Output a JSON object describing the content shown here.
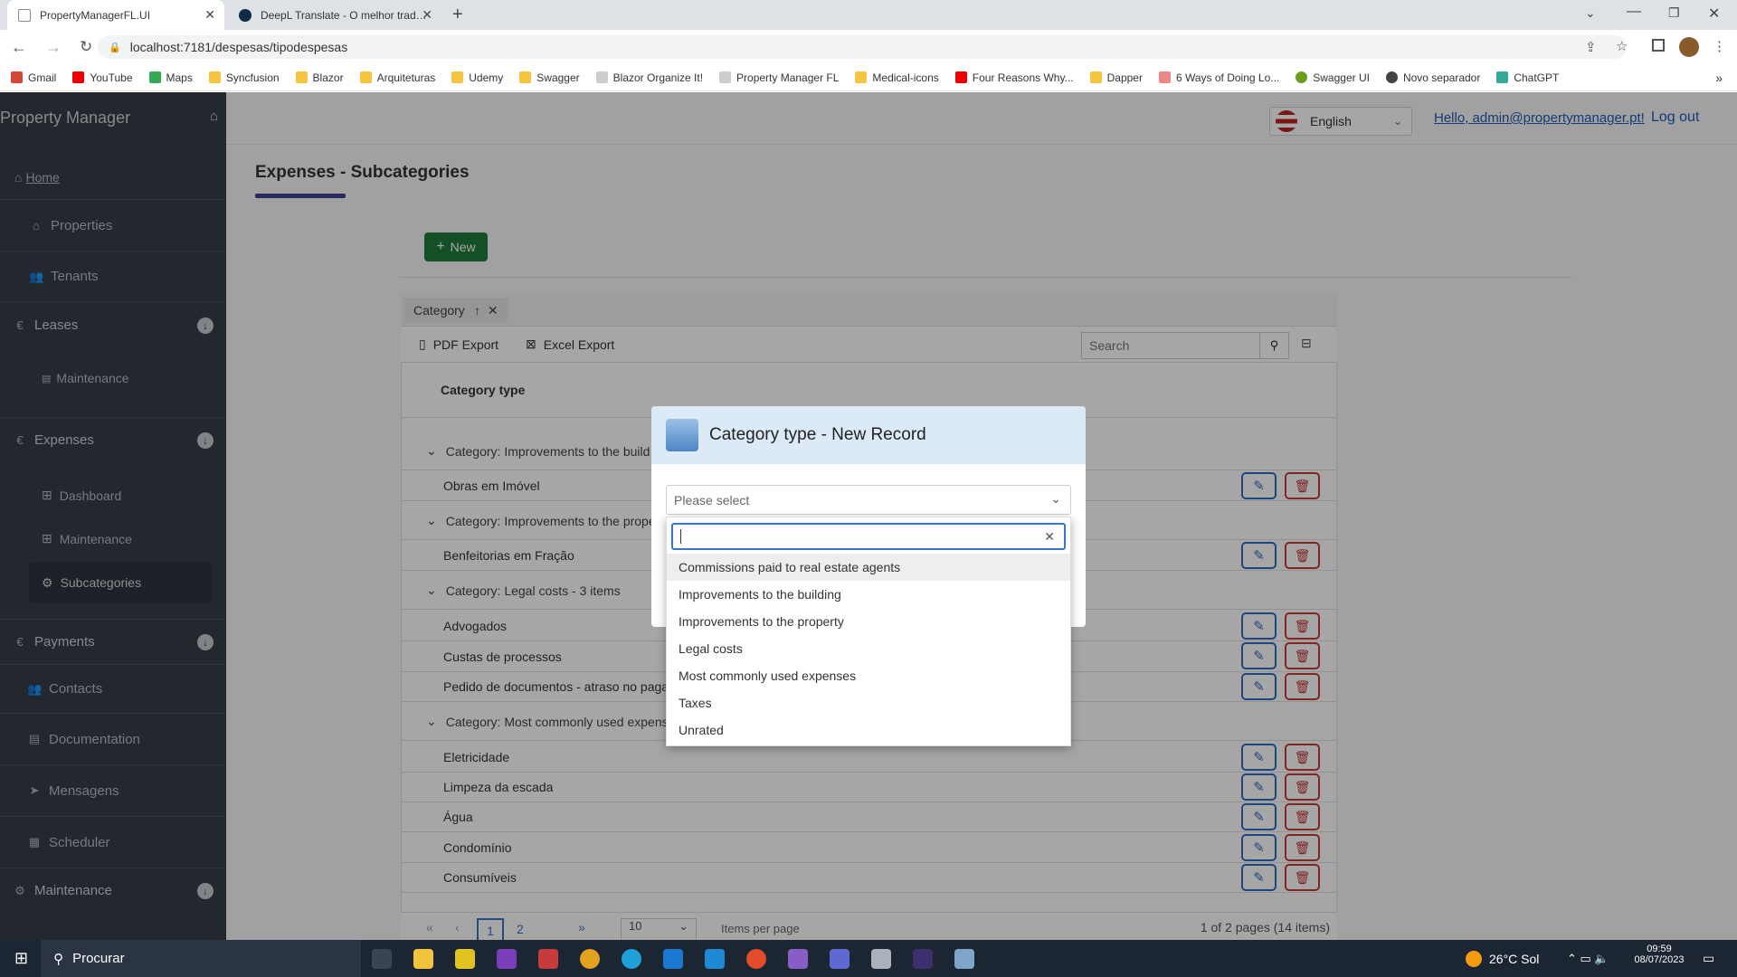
{
  "browser": {
    "tabs": [
      {
        "title": "PropertyManagerFL.UI"
      },
      {
        "title": "DeepL Translate - O melhor trad…"
      }
    ],
    "url": "localhost:7181/despesas/tipodespesas",
    "bookmarks": [
      "Gmail",
      "YouTube",
      "Maps",
      "Syncfusion",
      "Blazor",
      "Arquiteturas",
      "Udemy",
      "Swagger",
      "Blazor Organize It!",
      "Property Manager FL",
      "Medical-icons",
      "Four Reasons Why...",
      "Dapper",
      "6 Ways of Doing Lo...",
      "Swagger UI",
      "Novo separador",
      "ChatGPT"
    ]
  },
  "sidebar": {
    "brand": "Property Manager",
    "home": "Home",
    "items": {
      "properties": "Properties",
      "tenants": "Tenants",
      "leases": "Leases",
      "leases_maintenance": "Maintenance",
      "expenses": "Expenses",
      "dashboard": "Dashboard",
      "expenses_maintenance": "Maintenance",
      "subcategories": "Subcategories",
      "payments": "Payments",
      "contacts": "Contacts",
      "documentation": "Documentation",
      "mensagens": "Mensagens",
      "scheduler": "Scheduler",
      "maintenance": "Maintenance"
    }
  },
  "header": {
    "language": "English",
    "greeting": "Hello, admin@propertymanager.pt!",
    "logout": "Log out"
  },
  "page": {
    "title": "Expenses - Subcategories",
    "new_button": "New",
    "group_chip": "Category",
    "pdf_export": "PDF Export",
    "excel_export": "Excel Export",
    "search_placeholder": "Search",
    "column_header": "Category type",
    "groups": [
      {
        "caption": "Category: Improvements to the build",
        "rows": [
          "Obras em Imóvel"
        ]
      },
      {
        "caption": "Category: Improvements to the prope",
        "rows": [
          "Benfeitorias em Fração"
        ]
      },
      {
        "caption": "Category: Legal costs - 3 items",
        "rows": [
          "Advogados",
          "Custas de processos",
          "Pedido de documentos - atraso no paga"
        ]
      },
      {
        "caption": "Category: Most commonly used expens",
        "rows": [
          "Eletricidade",
          "Limpeza da escada",
          "Água",
          "Condomínio",
          "Consumíveis"
        ]
      }
    ],
    "pager": {
      "first": "«",
      "prev": "‹",
      "pages": [
        "1",
        "2"
      ],
      "last": "»",
      "page_size": "10",
      "items_per_page": "Items per page",
      "summary": "1 of 2 pages (14 items)"
    }
  },
  "dialog": {
    "title": "Category type - New Record",
    "select_placeholder": "Please select",
    "options": [
      "Commissions paid to real estate agents",
      "Improvements to the building",
      "Improvements to the property",
      "Legal costs",
      "Most commonly used expenses",
      "Taxes",
      "Unrated"
    ]
  },
  "taskbar": {
    "search": "Procurar",
    "weather": "26°C  Sol",
    "time": "09:59",
    "date": "08/07/2023"
  },
  "colors": {
    "sidebar": "#373d47",
    "accent": "#2e6bc6",
    "new_button": "#1f7a3a",
    "delete": "#c93636"
  }
}
